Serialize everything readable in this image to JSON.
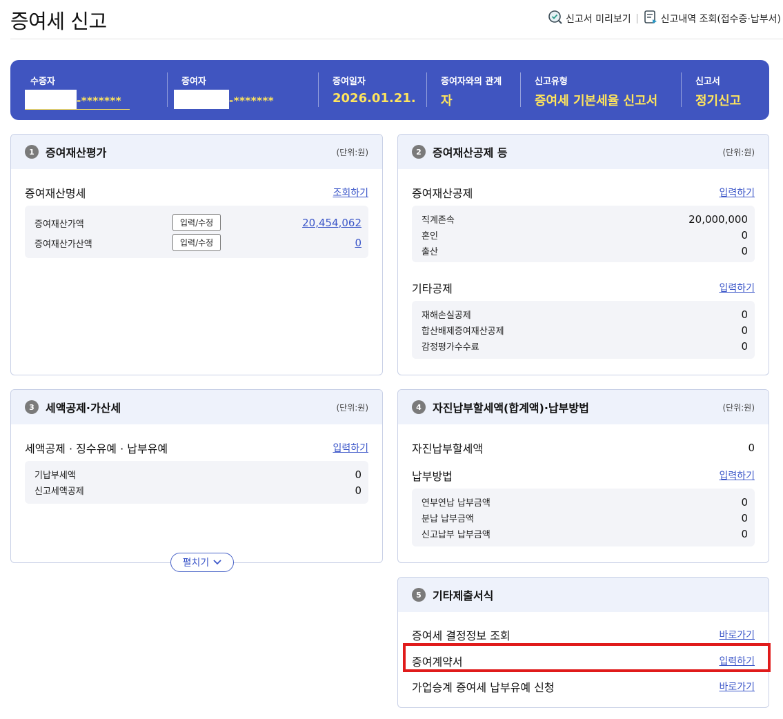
{
  "page": {
    "title": "증여세 신고",
    "links": [
      {
        "label": "신고서 미리보기",
        "icon": "search-check-icon"
      },
      {
        "label": "신고내역 조회(접수증·납부서)",
        "icon": "document-list-icon"
      }
    ]
  },
  "summary": {
    "recipient": {
      "label": "수증자",
      "value": "-*******"
    },
    "donor": {
      "label": "증여자",
      "value": "-*******"
    },
    "date": {
      "label": "증여일자",
      "value": "2026.01.21."
    },
    "relation": {
      "label": "증여자와의 관계",
      "value": "자"
    },
    "type": {
      "label": "신고유형",
      "value": "증여세 기본세율 신고서"
    },
    "form": {
      "label": "신고서",
      "value": "정기신고"
    }
  },
  "cards": {
    "c1": {
      "num": "1",
      "title": "증여재산평가",
      "unit": "(단위:원)",
      "section": {
        "title": "증여재산명세",
        "link": "조회하기"
      },
      "rows": [
        {
          "label": "증여재산가액",
          "button": "입력/수정",
          "value": "20,454,062"
        },
        {
          "label": "증여재산가산액",
          "button": "입력/수정",
          "value": "0"
        }
      ]
    },
    "c2": {
      "num": "2",
      "title": "증여재산공제 등",
      "unit": "(단위:원)",
      "section1": {
        "title": "증여재산공제",
        "link": "입력하기"
      },
      "rows1": [
        {
          "label": "직계존속",
          "value": "20,000,000"
        },
        {
          "label": "혼인",
          "value": "0"
        },
        {
          "label": "출산",
          "value": "0"
        }
      ],
      "section2": {
        "title": "기타공제",
        "link": "입력하기"
      },
      "rows2": [
        {
          "label": "재해손실공제",
          "value": "0"
        },
        {
          "label": "합산배제증여재산공제",
          "value": "0"
        },
        {
          "label": "감정평가수수료",
          "value": "0"
        }
      ]
    },
    "c3": {
      "num": "3",
      "title": "세액공제·가산세",
      "unit": "(단위:원)",
      "section": {
        "title": "세액공제 · 징수유예 · 납부유예",
        "link": "입력하기"
      },
      "rows": [
        {
          "label": "기납부세액",
          "value": "0"
        },
        {
          "label": "신고세액공제",
          "value": "0"
        }
      ],
      "expand": "펼치기"
    },
    "c4": {
      "num": "4",
      "title": "자진납부할세액(합계액)·납부방법",
      "unit": "(단위:원)",
      "section1": {
        "title": "자진납부할세액",
        "value": "0"
      },
      "section2": {
        "title": "납부방법",
        "link": "입력하기"
      },
      "rows": [
        {
          "label": "연부연납 납부금액",
          "value": "0"
        },
        {
          "label": "분납 납부금액",
          "value": "0"
        },
        {
          "label": "신고납부 납부금액",
          "value": "0"
        }
      ]
    },
    "c5": {
      "num": "5",
      "title": "기타제출서식",
      "items": [
        {
          "title": "증여세 결정정보 조회",
          "link": "바로가기"
        },
        {
          "title": "증여계약서",
          "link": "입력하기"
        },
        {
          "title": "가업승계 증여세 납부유예 신청",
          "link": "바로가기"
        }
      ]
    }
  },
  "colors": {
    "accent": "#4055c0",
    "highlight_value": "#ffe55c",
    "link": "#3a55c8",
    "highlight_border": "#e01b1b"
  }
}
